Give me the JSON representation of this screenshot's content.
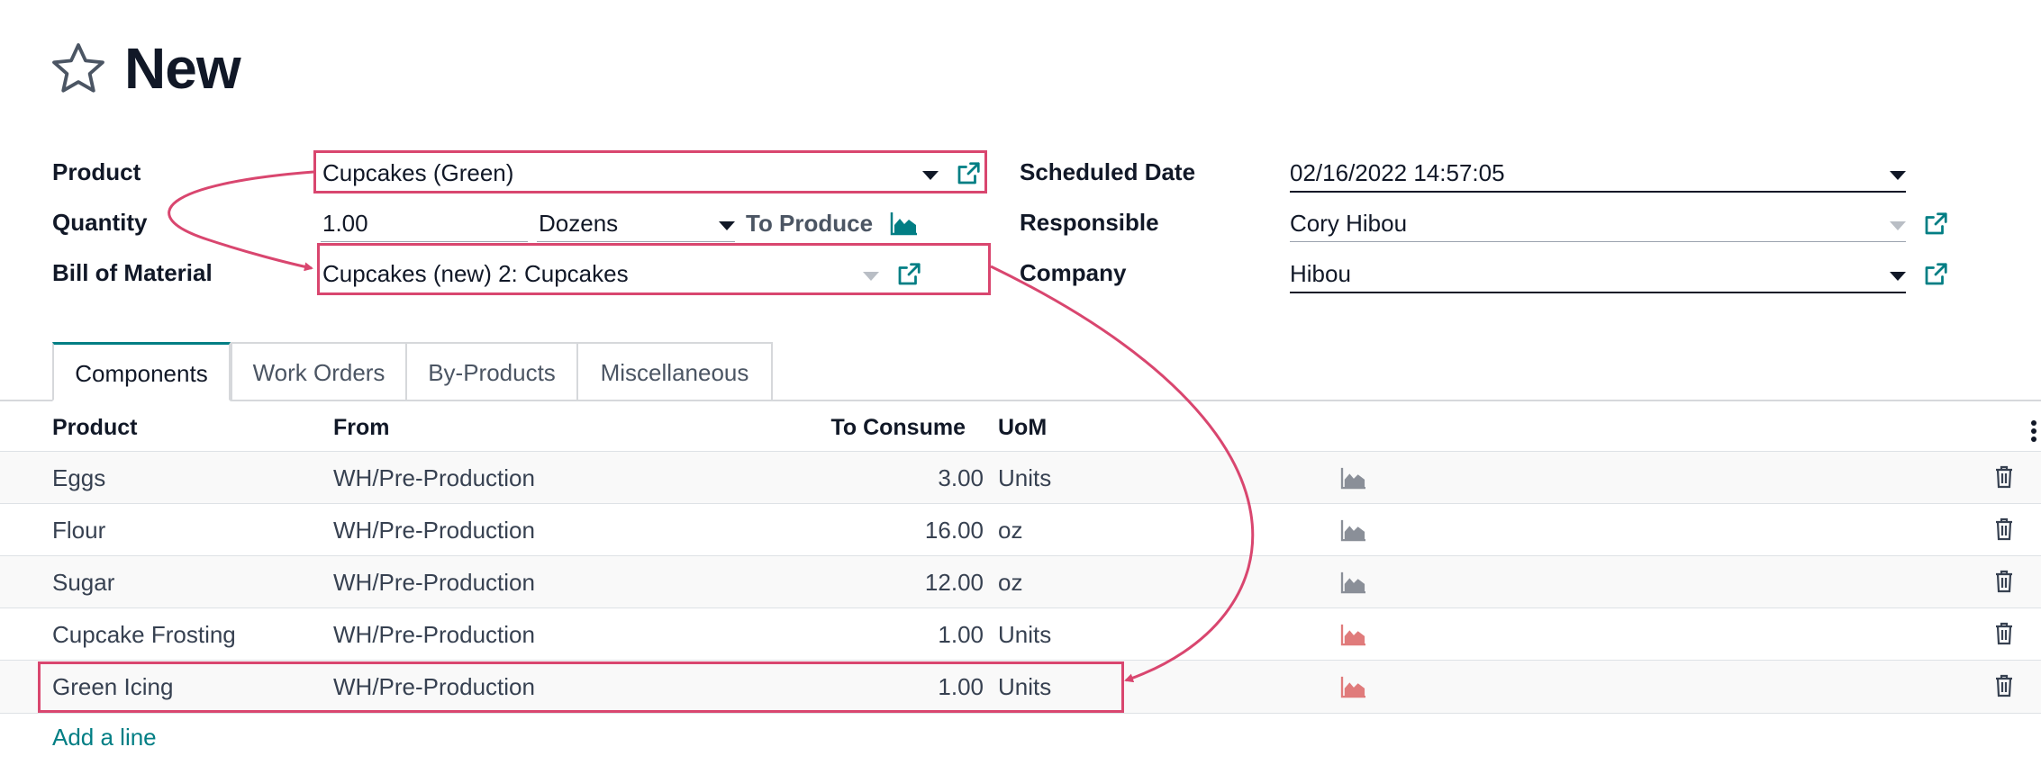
{
  "page": {
    "title": "New"
  },
  "form": {
    "product_label": "Product",
    "product_value": "Cupcakes (Green)",
    "quantity_label": "Quantity",
    "quantity_value": "1.00",
    "uom_value": "Dozens",
    "to_produce_label": "To Produce",
    "bom_label": "Bill of Material",
    "bom_value": "Cupcakes (new) 2: Cupcakes",
    "scheduled_date_label": "Scheduled Date",
    "scheduled_date_value": "02/16/2022 14:57:05",
    "responsible_label": "Responsible",
    "responsible_value": "Cory Hibou",
    "company_label": "Company",
    "company_value": "Hibou"
  },
  "tabs": [
    {
      "label": "Components",
      "active": true
    },
    {
      "label": "Work Orders"
    },
    {
      "label": "By-Products"
    },
    {
      "label": "Miscellaneous"
    }
  ],
  "table": {
    "headers": {
      "product": "Product",
      "from": "From",
      "to_consume": "To Consume",
      "uom": "UoM"
    },
    "rows": [
      {
        "product": "Eggs",
        "from": "WH/Pre-Production",
        "to_consume": "3.00",
        "uom": "Units",
        "forecast_status": "available"
      },
      {
        "product": "Flour",
        "from": "WH/Pre-Production",
        "to_consume": "16.00",
        "uom": "oz",
        "forecast_status": "available"
      },
      {
        "product": "Sugar",
        "from": "WH/Pre-Production",
        "to_consume": "12.00",
        "uom": "oz",
        "forecast_status": "available"
      },
      {
        "product": "Cupcake Frosting",
        "from": "WH/Pre-Production",
        "to_consume": "1.00",
        "uom": "Units",
        "forecast_status": "unavailable"
      },
      {
        "product": "Green Icing",
        "from": "WH/Pre-Production",
        "to_consume": "1.00",
        "uom": "Units",
        "forecast_status": "unavailable"
      }
    ],
    "add_line_label": "Add a line"
  },
  "icons": {
    "title": "star-outline-icon",
    "external_link": "external-link-icon",
    "forecast": "area-chart-icon",
    "delete": "trash-icon",
    "options": "vertical-dots-icon"
  },
  "colors": {
    "accent": "#017e84",
    "annotation": "#d9466f",
    "forecast_available": "#8a8f98",
    "forecast_unavailable": "#e07b7b"
  }
}
